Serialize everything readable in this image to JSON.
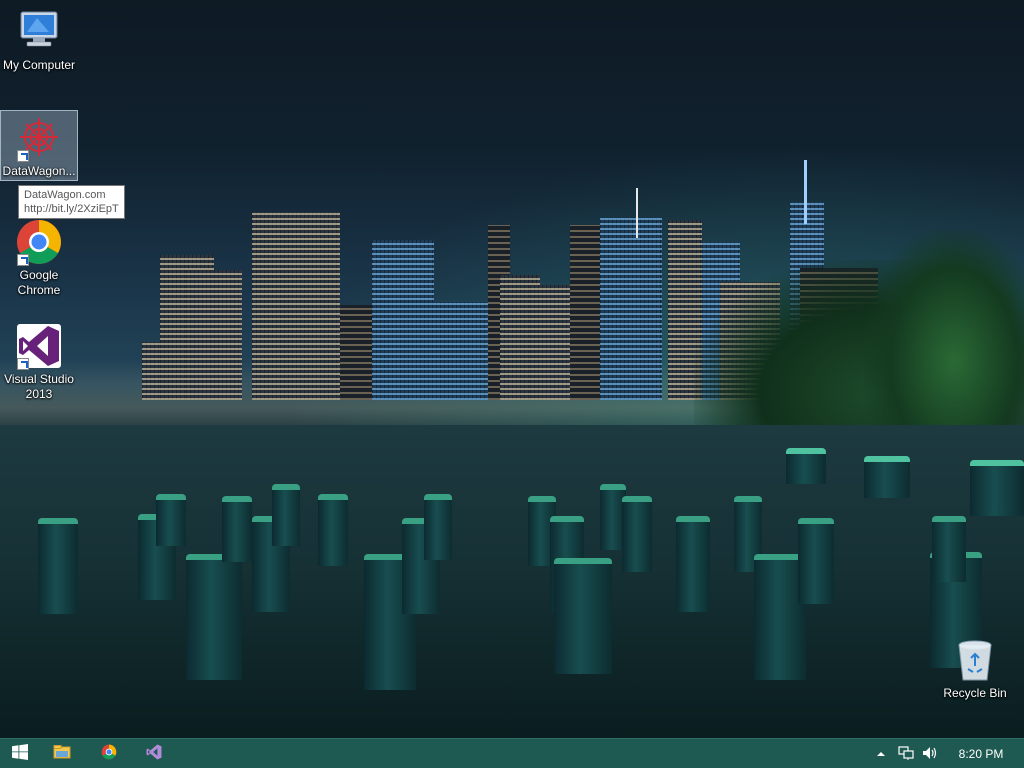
{
  "desktop": {
    "icons": [
      {
        "label": "My Computer",
        "icon": "computer-icon"
      },
      {
        "label": "DataWagon...",
        "icon": "datawagon-icon"
      },
      {
        "label": "Google Chrome",
        "icon": "chrome-icon"
      },
      {
        "label": "Visual Studio 2013",
        "icon": "visual-studio-icon"
      },
      {
        "label": "Recycle Bin",
        "icon": "recycle-bin-icon"
      }
    ],
    "tooltip": {
      "line1": "DataWagon.com",
      "line2": "http://bit.ly/2XziEpT"
    }
  },
  "taskbar": {
    "pinned": [
      {
        "name": "start",
        "icon": "windows-logo-icon"
      },
      {
        "name": "file-explorer",
        "icon": "folder-icon"
      },
      {
        "name": "chrome",
        "icon": "chrome-icon"
      },
      {
        "name": "visual-studio",
        "icon": "visual-studio-icon"
      }
    ],
    "tray": {
      "clock": "8:20 PM",
      "icons": [
        "chevron-up-icon",
        "network-icon",
        "volume-icon"
      ]
    },
    "color": "#1f5a52"
  }
}
